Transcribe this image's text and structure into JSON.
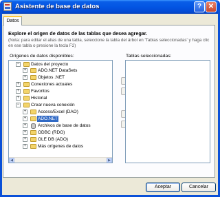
{
  "window": {
    "title": "Asistente de base de datos"
  },
  "tabs": [
    {
      "label": "Datos"
    }
  ],
  "header": {
    "heading": "Explore el origen de datos de las tablas que desea agregar.",
    "note": "(Nota: para editar el alias de una tabla, seleccione la tabla del árbol en 'Tablas seleccionadas' y haga clic en ese tabla o presione la tecla F2)"
  },
  "sources": {
    "label": "Orígenes de datos disponibles:",
    "items": [
      {
        "label": "Datos del proyecto",
        "expander": "−"
      },
      {
        "label": "ADO.NET DataSets",
        "expander": "+"
      },
      {
        "label": "Objetos .NET",
        "expander": "+"
      },
      {
        "label": "Conexiones actuales",
        "expander": "+"
      },
      {
        "label": "Favoritos",
        "expander": "+"
      },
      {
        "label": "Historial",
        "expander": "+"
      },
      {
        "label": "Crear nueva conexión",
        "expander": "−"
      },
      {
        "label": "Access/Excel (DAO)",
        "expander": "+"
      },
      {
        "label": "ADO.NET",
        "expander": "+"
      },
      {
        "label": "Archivos de base de datos",
        "expander": "+"
      },
      {
        "label": "ODBC (RDO)",
        "expander": "+"
      },
      {
        "label": "OLE DB (ADO)",
        "expander": "+"
      },
      {
        "label": "Más orígenes de datos",
        "expander": "+"
      }
    ]
  },
  "selected_tables": {
    "label": "Tablas seleccionadas:"
  },
  "move_buttons": {
    "add": ">",
    "add_all": ">>",
    "remove": "<",
    "remove_all": "<<"
  },
  "buttons": {
    "ok": "Aceptar",
    "cancel": "Cancelar"
  },
  "titlebar_buttons": {
    "help": "?",
    "close": "✕"
  },
  "colors": {
    "titlebar": "#0355e3",
    "selection": "#316ac5",
    "face": "#ece9d8"
  }
}
